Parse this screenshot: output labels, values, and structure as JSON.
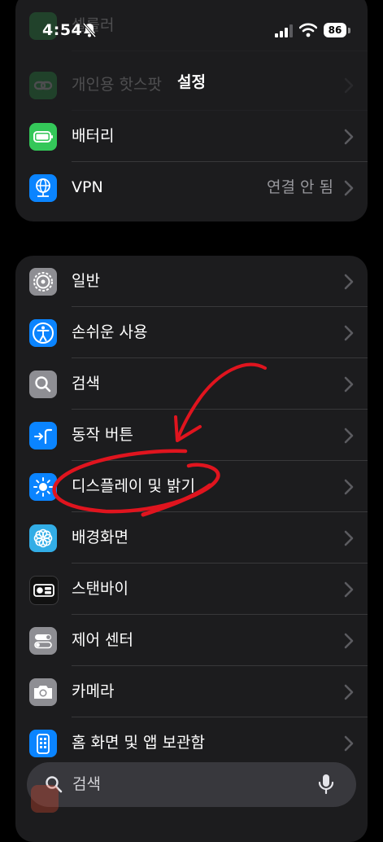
{
  "status": {
    "time": "4:54",
    "battery": "86"
  },
  "nav": {
    "title": "설정"
  },
  "group1": [
    {
      "label": "셀룰러",
      "color": "#34c759",
      "icon": "antenna-icon",
      "faded": true
    },
    {
      "label": "개인용 핫스팟",
      "color": "#34c759",
      "icon": "link-icon",
      "faded": true
    },
    {
      "label": "배터리",
      "color": "#34c759",
      "icon": "battery-icon"
    },
    {
      "label": "VPN",
      "detail": "연결 안 됨",
      "color": "#0a84ff",
      "icon": "globe-icon"
    }
  ],
  "group2": [
    {
      "label": "일반",
      "color": "#8e8e93",
      "icon": "gear-icon"
    },
    {
      "label": "손쉬운 사용",
      "color": "#0a84ff",
      "icon": "accessibility-icon"
    },
    {
      "label": "검색",
      "color": "#8e8e93",
      "icon": "magnifier-icon"
    },
    {
      "label": "동작 버튼",
      "color": "#0a84ff",
      "icon": "action-button-icon"
    },
    {
      "label": "디스플레이 및 밝기",
      "color": "#0a84ff",
      "icon": "sun-icon"
    },
    {
      "label": "배경화면",
      "color": "#32ade6",
      "icon": "flower-icon"
    },
    {
      "label": "스탠바이",
      "color": "#111111",
      "icon": "standby-icon"
    },
    {
      "label": "제어 센터",
      "color": "#8e8e93",
      "icon": "toggles-icon"
    },
    {
      "label": "카메라",
      "color": "#8e8e93",
      "icon": "camera-icon"
    },
    {
      "label": "홈 화면 및 앱 보관함",
      "color": "#0a84ff",
      "icon": "home-screen-icon"
    }
  ],
  "search": {
    "placeholder": "검색"
  },
  "annotation": {
    "color": "#e0141e"
  }
}
